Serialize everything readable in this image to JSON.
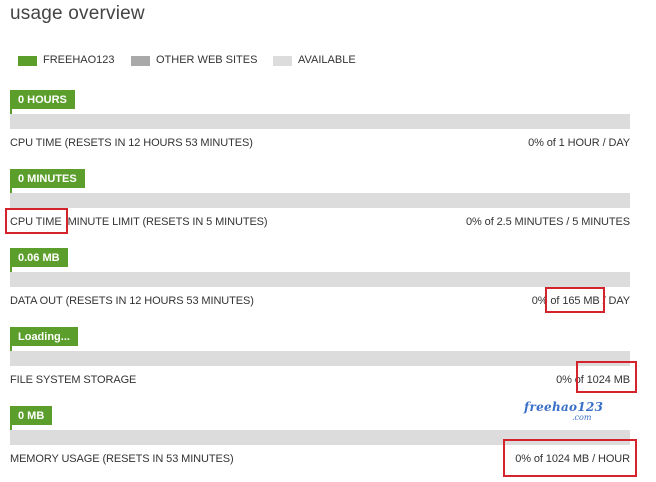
{
  "page": {
    "title": "usage overview"
  },
  "legend": [
    {
      "label": "FREEHAO123",
      "color": "#5c9e2c"
    },
    {
      "label": "OTHER WEB SITES",
      "color": "#a9a9a9"
    },
    {
      "label": "AVAILABLE",
      "color": "#dcdcdc"
    }
  ],
  "colors": {
    "accent": "#5c9e2c",
    "track": "#dcdcdc",
    "highlight": "#d4232b"
  },
  "bars": [
    {
      "badge": "0 HOURS",
      "label": "CPU TIME",
      "sublabel": "(RESETS IN 12 HOURS 53 MINUTES)",
      "value": "0% of 1 HOUR / DAY",
      "fill_percent": 0
    },
    {
      "badge": "0 MINUTES",
      "label": "CPU TIME",
      "sublabel": "MINUTE LIMIT  (RESETS IN 5 MINUTES)",
      "value": "0% of 2.5 MINUTES / 5 MINUTES",
      "fill_percent": 0
    },
    {
      "badge": "0.06 MB",
      "label": "DATA OUT",
      "sublabel": "(RESETS IN 12 HOURS 53 MINUTES)",
      "value": "0% of 165 MB / DAY",
      "fill_percent": 0
    },
    {
      "badge": "Loading...",
      "label": "FILE SYSTEM STORAGE",
      "sublabel": "",
      "value": "0% of 1024 MB",
      "fill_percent": 0
    },
    {
      "badge": "0 MB",
      "label": "MEMORY USAGE",
      "sublabel": "(RESETS IN 53 MINUTES)",
      "value": "0% of 1024 MB / HOUR",
      "fill_percent": 0
    }
  ],
  "watermark": {
    "main": "freehao123",
    "sub": ".com"
  }
}
